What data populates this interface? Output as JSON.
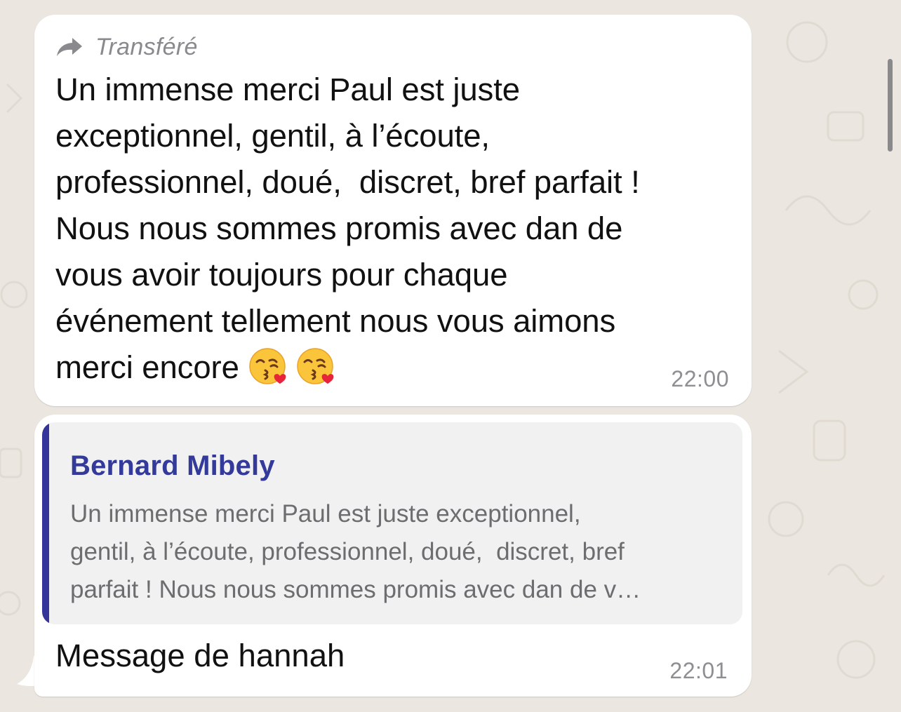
{
  "messages": [
    {
      "forwarded_label": "Transféré",
      "text": "Un immense merci Paul est juste\nexceptionnel, gentil, à l’écoute,\nprofessionnel, doué,  discret, bref parfait !\nNous nous sommes promis avec dan de\nvous avoir toujours pour chaque\névénement tellement nous vous aimons\nmerci encore ",
      "emojis": [
        "kissing-face-heart-emoji",
        "kissing-face-heart-emoji"
      ],
      "time": "22:00"
    },
    {
      "quote": {
        "author": "Bernard Mibely",
        "text": "Un immense merci Paul est juste exceptionnel,\ngentil, à l’écoute, professionnel, doué,  discret, bref\nparfait ! Nous nous sommes promis avec dan de v…"
      },
      "text": "Message de hannah",
      "time": "22:01"
    }
  ],
  "colors": {
    "wallpaper": "#ebe6df",
    "bubble": "#ffffff",
    "quote_accent": "#34349a",
    "quote_background": "#f1f1f2",
    "secondary_text": "#8e8e93"
  },
  "icons": {
    "forward": "forward-arrow-icon"
  }
}
